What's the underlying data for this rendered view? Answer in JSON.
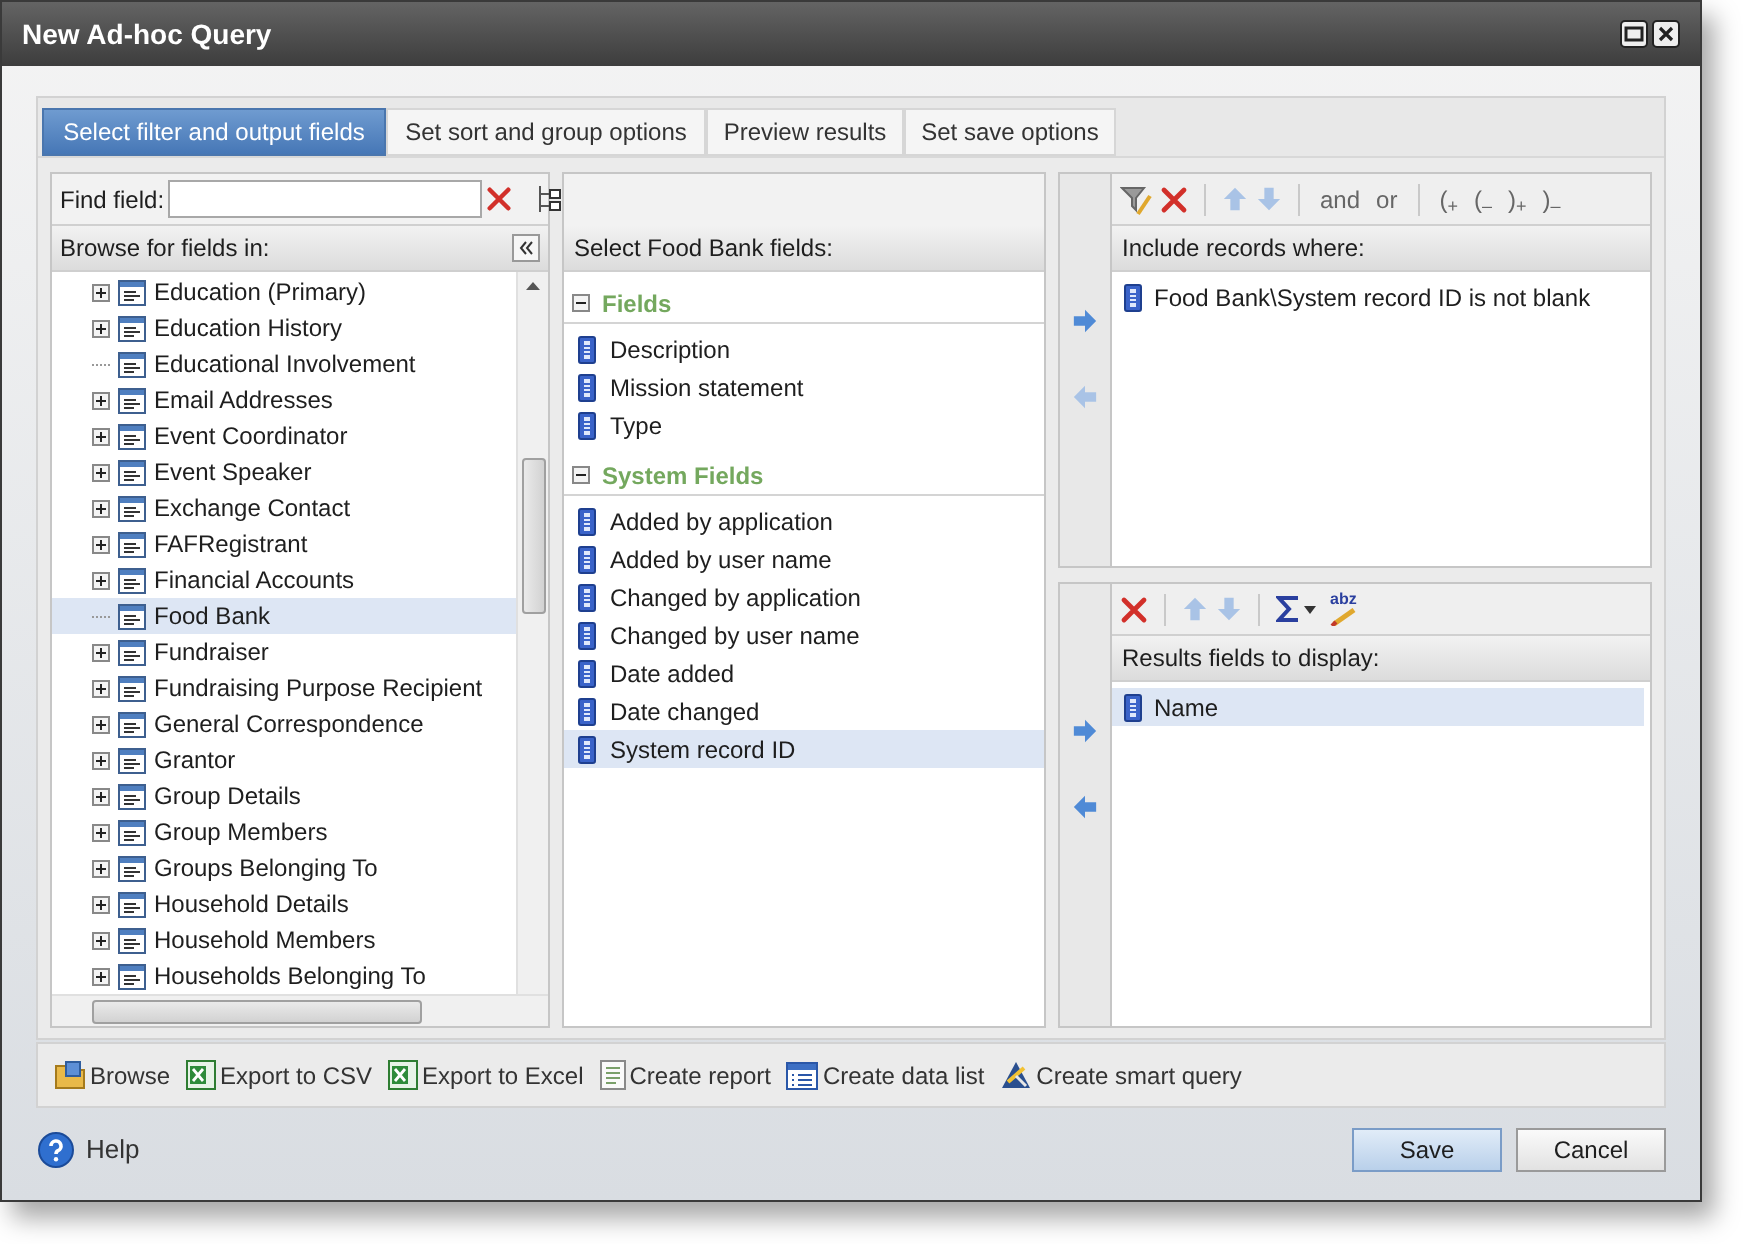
{
  "window": {
    "title": "New Ad-hoc Query"
  },
  "tabs": [
    {
      "label": "Select filter and output fields",
      "selected": true
    },
    {
      "label": "Set sort and group options",
      "selected": false
    },
    {
      "label": "Preview results",
      "selected": false
    },
    {
      "label": "Set save options",
      "selected": false
    }
  ],
  "find_field": {
    "label": "Find field:"
  },
  "browse": {
    "header": "Browse for fields in:",
    "items": [
      {
        "label": "Education (Primary)",
        "kind": "branch",
        "selected": false
      },
      {
        "label": "Education History",
        "kind": "branch",
        "selected": false
      },
      {
        "label": "Educational Involvement",
        "kind": "leaf",
        "selected": false
      },
      {
        "label": "Email Addresses",
        "kind": "branch",
        "selected": false
      },
      {
        "label": "Event Coordinator",
        "kind": "branch",
        "selected": false
      },
      {
        "label": "Event Speaker",
        "kind": "branch",
        "selected": false
      },
      {
        "label": "Exchange Contact",
        "kind": "branch",
        "selected": false
      },
      {
        "label": "FAFRegistrant",
        "kind": "branch",
        "selected": false
      },
      {
        "label": "Financial Accounts",
        "kind": "branch",
        "selected": false
      },
      {
        "label": "Food Bank",
        "kind": "leaf",
        "selected": true
      },
      {
        "label": "Fundraiser",
        "kind": "branch",
        "selected": false
      },
      {
        "label": "Fundraising Purpose Recipient",
        "kind": "branch",
        "selected": false
      },
      {
        "label": "General Correspondence",
        "kind": "branch",
        "selected": false
      },
      {
        "label": "Grantor",
        "kind": "branch",
        "selected": false
      },
      {
        "label": "Group Details",
        "kind": "branch",
        "selected": false
      },
      {
        "label": "Group Members",
        "kind": "branch",
        "selected": false
      },
      {
        "label": "Groups Belonging To",
        "kind": "branch",
        "selected": false
      },
      {
        "label": "Household Details",
        "kind": "branch",
        "selected": false
      },
      {
        "label": "Household Members",
        "kind": "branch",
        "selected": false
      },
      {
        "label": "Households Belonging To",
        "kind": "branch",
        "selected": false
      }
    ]
  },
  "fields_panel": {
    "header": "Select Food Bank fields:",
    "groups": [
      {
        "title": "Fields",
        "expanded": true,
        "fields": [
          {
            "label": "Description",
            "selected": false
          },
          {
            "label": "Mission statement",
            "selected": false
          },
          {
            "label": "Type",
            "selected": false
          }
        ]
      },
      {
        "title": "System Fields",
        "expanded": true,
        "fields": [
          {
            "label": "Added by application",
            "selected": false
          },
          {
            "label": "Added by user name",
            "selected": false
          },
          {
            "label": "Changed by application",
            "selected": false
          },
          {
            "label": "Changed by user name",
            "selected": false
          },
          {
            "label": "Date added",
            "selected": false
          },
          {
            "label": "Date changed",
            "selected": false
          },
          {
            "label": "System record ID",
            "selected": true
          }
        ]
      }
    ]
  },
  "filter_panel": {
    "operators": [
      "and",
      "or",
      "($_{+}$",
      "($_{–}$",
      ")$_{+}$",
      ")$_{–}$"
    ],
    "header": "Include records where:",
    "conditions": [
      "Food Bank\\System record ID is not blank"
    ]
  },
  "output_panel": {
    "rename_label": "abz",
    "header": "Results fields to display:",
    "fields": [
      {
        "label": "Name",
        "selected": true
      }
    ]
  },
  "actions": [
    {
      "kind": "folder",
      "label": "Browse"
    },
    {
      "kind": "excel",
      "label": "Export to CSV"
    },
    {
      "kind": "excel",
      "label": "Export to Excel"
    },
    {
      "kind": "report",
      "label": "Create report"
    },
    {
      "kind": "list",
      "label": "Create data list"
    },
    {
      "kind": "smart",
      "label": "Create smart query"
    }
  ],
  "help": {
    "label": "Help"
  },
  "buttons": [
    {
      "label": "Save",
      "primary": true
    },
    {
      "label": "Cancel",
      "primary": false
    }
  ]
}
